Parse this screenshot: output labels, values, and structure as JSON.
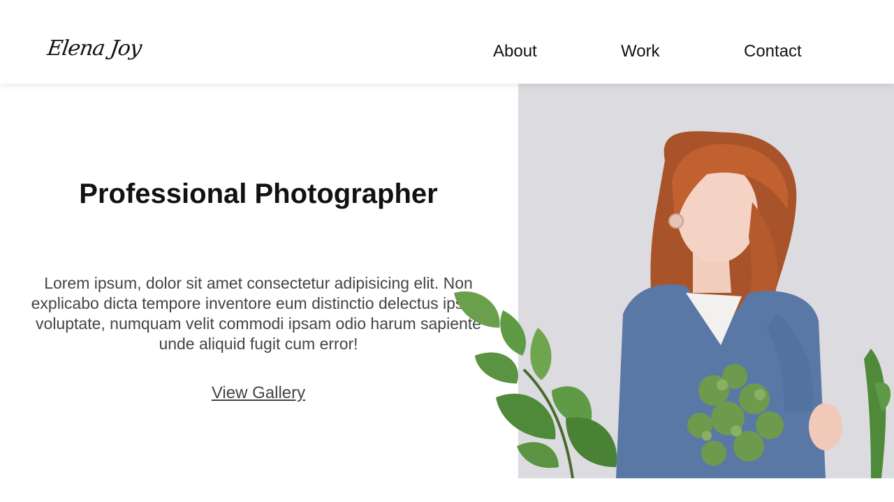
{
  "header": {
    "logo": "Elena Joy",
    "nav": [
      "About",
      "Work",
      "Contact"
    ]
  },
  "hero": {
    "title": "Professional Photographer",
    "description": "Lorem ipsum, dolor sit amet consectetur adipisicing elit. Non explicabo dicta tempore inventore eum distinctio delectus ipsum voluptate, numquam velit commodi ipsam odio harum sapiente unde aliquid fugit cum error!",
    "cta": "View Gallery"
  },
  "colors": {
    "background": "#ffffff",
    "photo_background": "#dcdbdf",
    "sweater": "#5a78a6",
    "hair": "#b85a2e",
    "plant": "#4f8a3a"
  }
}
